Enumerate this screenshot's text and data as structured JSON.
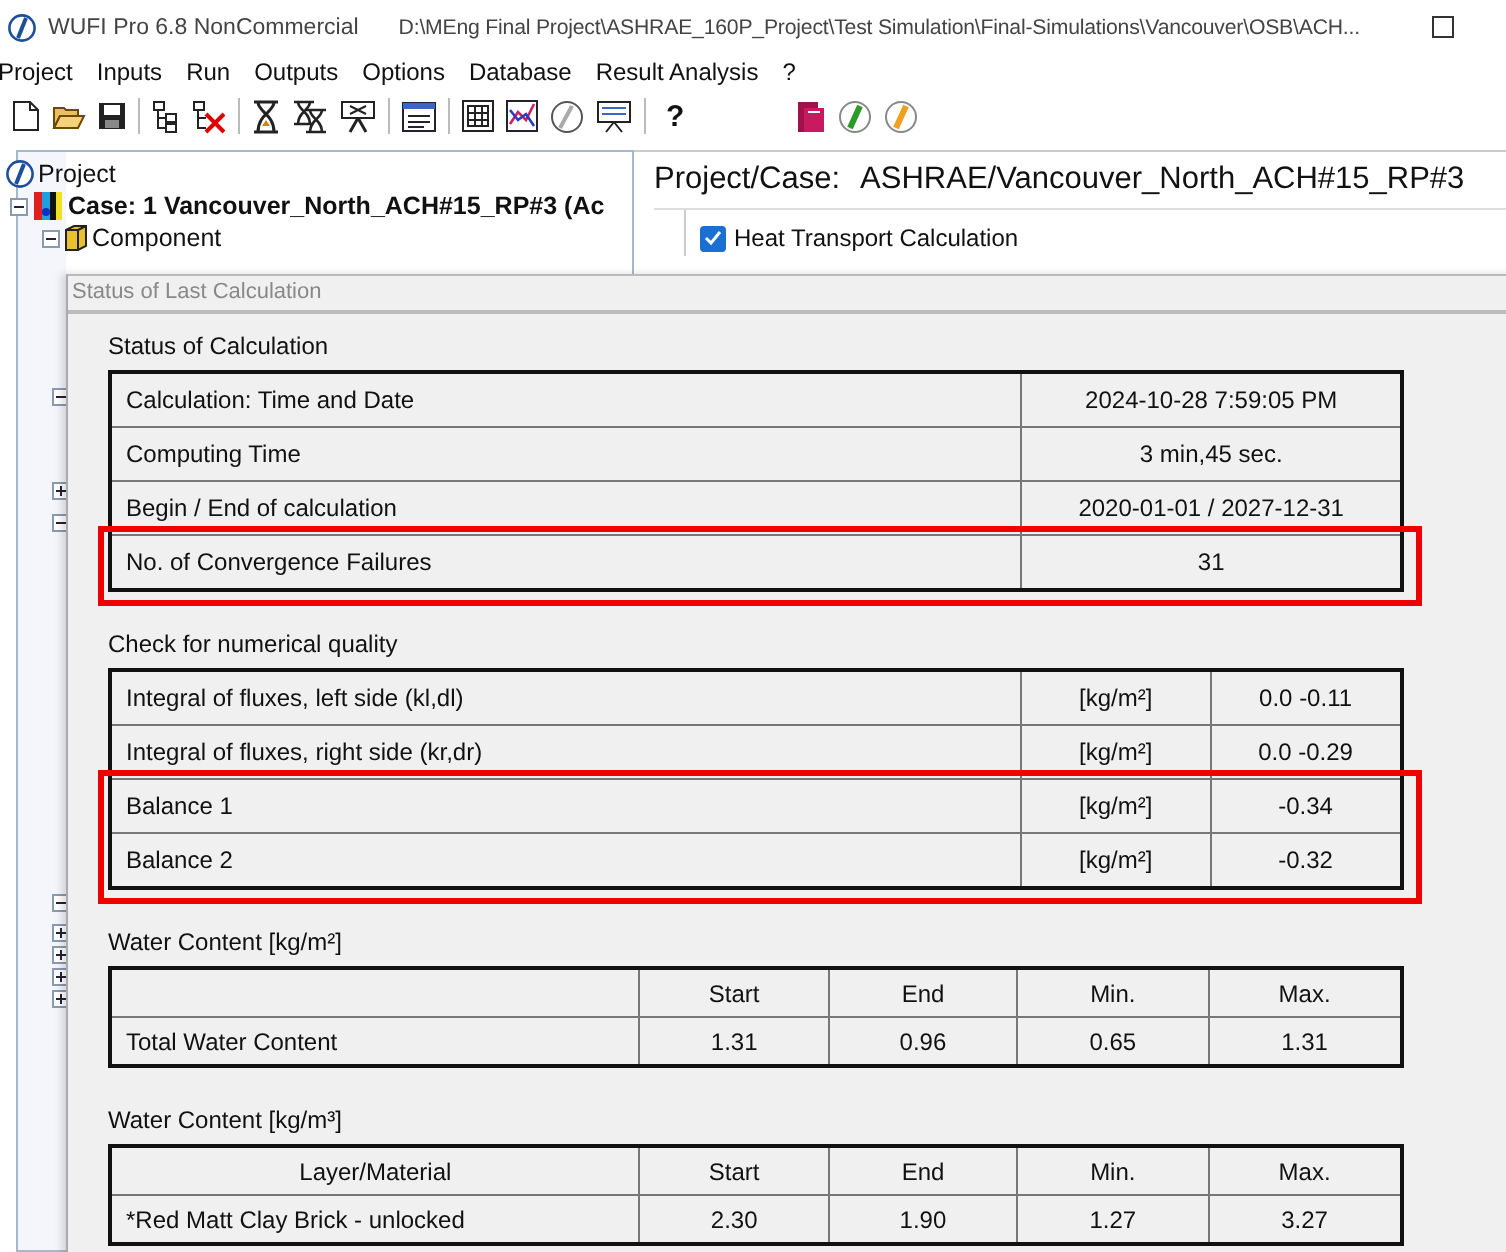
{
  "window": {
    "title": "WUFI Pro 6.8 NonCommercial",
    "path": "D:\\MEng Final Project\\ASHRAE_160P_Project\\Test Simulation\\Final-Simulations\\Vancouver\\OSB\\ACH..."
  },
  "menu": [
    "Project",
    "Inputs",
    "Run",
    "Outputs",
    "Options",
    "Database",
    "Result Analysis",
    "?"
  ],
  "toolbar": {
    "help": "?"
  },
  "tree": [
    {
      "label": "Project",
      "children": [
        {
          "label": "Case: 1 Vancouver_North_ACH#15_RP#3 (Ac",
          "expanded": true,
          "children": [
            {
              "label": "Component",
              "expanded": true
            }
          ]
        }
      ]
    }
  ],
  "hidden_tree_nodes": [
    {
      "expanded": true
    },
    {
      "expanded": false
    },
    {
      "expanded": true
    },
    {
      "expanded": true
    },
    {
      "expanded": false
    },
    {
      "expanded": false
    },
    {
      "expanded": false
    },
    {
      "expanded": false
    }
  ],
  "case_panel": {
    "label": "Project/Case:",
    "value": "ASHRAE/Vancouver_North_ACH#15_RP#3",
    "options": [
      {
        "label": "Heat Transport Calculation",
        "checked": true
      }
    ]
  },
  "dialog": {
    "title": "Status of Last Calculation",
    "sections": [
      {
        "title": "Status of Calculation",
        "rows": [
          {
            "cells": [
              "Calculation: Time and Date",
              "2024-10-28 7:59:05 PM"
            ],
            "highlighted": false
          },
          {
            "cells": [
              "Computing Time",
              "3 min,45 sec."
            ],
            "highlighted": false
          },
          {
            "cells": [
              "Begin / End of calculation",
              "2020-01-01 / 2027-12-31"
            ],
            "highlighted": false
          },
          {
            "cells": [
              "No. of Convergence Failures",
              "31"
            ],
            "highlighted": true
          }
        ]
      },
      {
        "title": "Check for numerical quality",
        "rows": [
          {
            "cells": [
              "Integral of fluxes, left side (kl,dl)",
              "[kg/m²]",
              "0.0  -0.11"
            ],
            "highlighted": false
          },
          {
            "cells": [
              "Integral of fluxes, right side (kr,dr)",
              "[kg/m²]",
              "0.0  -0.29"
            ],
            "highlighted": false
          },
          {
            "cells": [
              "Balance 1",
              "[kg/m²]",
              "-0.34"
            ],
            "highlighted": true
          },
          {
            "cells": [
              "Balance 2",
              "[kg/m²]",
              "-0.32"
            ],
            "highlighted": true
          }
        ]
      },
      {
        "title": "Water Content [kg/m²]",
        "columns": [
          "",
          "Start",
          "End",
          "Min.",
          "Max."
        ],
        "rows": [
          {
            "cells": [
              "Total Water Content",
              "1.31",
              "0.96",
              "0.65",
              "1.31"
            ],
            "highlighted": false
          }
        ]
      },
      {
        "title": "Water Content [kg/m³]",
        "columns": [
          "Layer/Material",
          "Start",
          "End",
          "Min.",
          "Max."
        ],
        "rows": [
          {
            "cells": [
              "*Red Matt Clay Brick - unlocked",
              "2.30",
              "1.90",
              "1.27",
              "3.27"
            ],
            "highlighted": false
          }
        ]
      }
    ]
  }
}
